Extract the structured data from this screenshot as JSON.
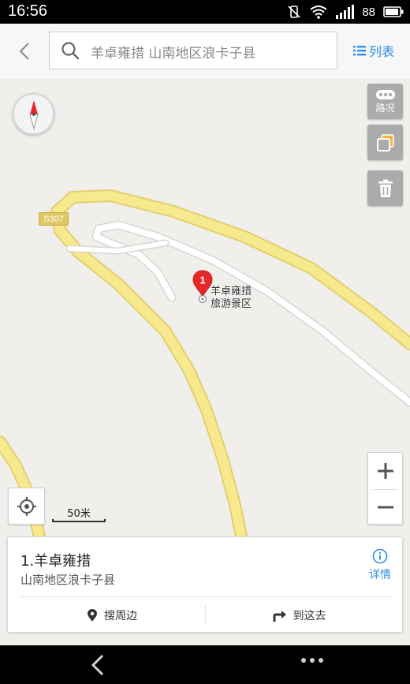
{
  "status_bar": {
    "time": "16:56",
    "battery": "88",
    "icons": [
      "vibrate-off-icon",
      "wifi-icon",
      "signal-icon",
      "battery-icon"
    ]
  },
  "top_bar": {
    "search_text": "羊卓雍措 山南地区浪卡子县",
    "list_label": "列表"
  },
  "map": {
    "traffic_label": "路况",
    "road_label": "S307",
    "poi_marker_number": "1",
    "poi_label_line1": "羊卓雍措",
    "poi_label_line2": "旅游景区",
    "scale_label": "50米",
    "colors": {
      "background": "#f0efec",
      "major_road": "#f7e98e",
      "major_road_edge": "#e3cf6e",
      "minor_road": "#ffffff",
      "marker": "#e8262a"
    }
  },
  "result_card": {
    "title": "1.羊卓雍措",
    "subtitle": "山南地区浪卡子县",
    "detail_label": "详情",
    "nearby_label": "搜周边",
    "route_label": "到这去"
  },
  "accent_color": "#2f8fe6"
}
